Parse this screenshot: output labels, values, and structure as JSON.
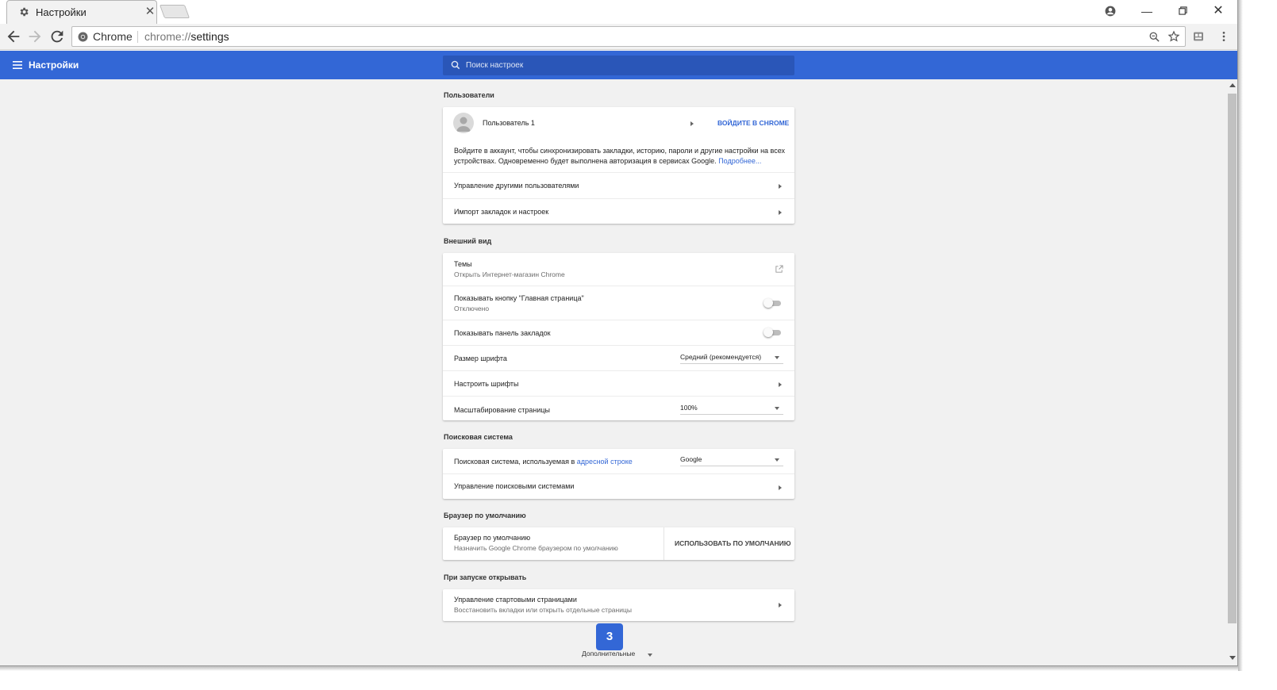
{
  "browser": {
    "tab_title": "Настройки",
    "omnibox_chip": "Chrome",
    "url_scheme": "chrome://",
    "url_path": "settings"
  },
  "header": {
    "title": "Настройки",
    "search_placeholder": "Поиск настроек"
  },
  "users": {
    "section_title": "Пользователи",
    "user_name": "Пользователь 1",
    "signin_label": "ВОЙДИТЕ В CHROME",
    "sync_text_1": "Войдите в аккаунт, чтобы синхронизировать закладки, историю, пароли и другие настройки на всех",
    "sync_text_2": "устройствах. Одновременно будет выполнена авторизация в сервисах Google.",
    "more_link": "Подробнее...",
    "manage_others": "Управление другими пользователями",
    "import": "Импорт закладок и настроек"
  },
  "appearance": {
    "section_title": "Внешний вид",
    "themes_label": "Темы",
    "themes_sub": "Открыть Интернет-магазин Chrome",
    "home_button_label": "Показывать кнопку \"Главная страница\"",
    "home_button_sub": "Отключено",
    "bookmarks_bar_label": "Показывать панель закладок",
    "font_size_label": "Размер шрифта",
    "font_size_value": "Средний (рекомендуется)",
    "customize_fonts": "Настроить шрифты",
    "zoom_label": "Масштабирование страницы",
    "zoom_value": "100%"
  },
  "search_engine": {
    "section_title": "Поисковая система",
    "engine_label": "Поисковая система, используемая в",
    "engine_link": "адресной строке",
    "engine_value": "Google",
    "manage": "Управление поисковыми системами"
  },
  "default_browser": {
    "section_title": "Браузер по умолчанию",
    "label": "Браузер по умолчанию",
    "sub": "Назначить Google Chrome браузером по умолчанию",
    "button": "ИСПОЛЬЗОВАТЬ ПО УМОЛЧАНИЮ"
  },
  "startup": {
    "section_title": "При запуске открывать",
    "label": "Управление стартовыми страницами",
    "sub": "Восстановить вкладки или открыть отдельные страницы"
  },
  "footer": {
    "badge": "3",
    "advanced": "Дополнительные"
  },
  "colors": {
    "accent": "#3367d6",
    "header_bg": "#3367d6",
    "page_bg": "#f1f1f1"
  }
}
